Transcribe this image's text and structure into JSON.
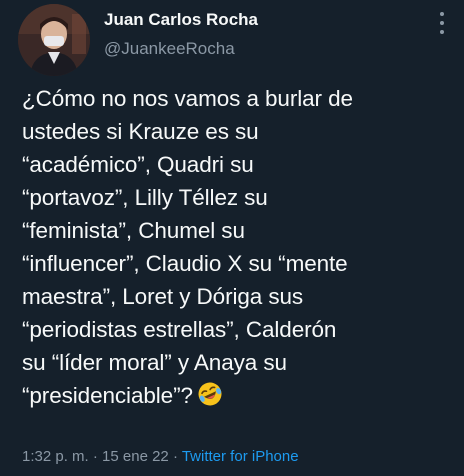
{
  "author": {
    "name": "Juan Carlos Rocha",
    "handle": "@JuankeeRocha"
  },
  "tweet": {
    "lines": [
      "¿Cómo no nos vamos a burlar de",
      "ustedes si Krauze es su",
      "“académico”, Quadri su",
      "“portavoz”, Lilly Téllez su",
      "“feminista”, Chumel su",
      "“influencer”, Claudio X su “mente",
      "maestra”, Loret y Dóriga sus",
      "“periodistas estrellas”, Calderón",
      "su “líder moral” y Anaya su",
      "“presidenciable”?"
    ],
    "emoji": "rolling-on-the-floor-laughing-icon"
  },
  "meta": {
    "time": "1:32 p. m.",
    "sep1": " · ",
    "date": "15 ene 22",
    "sep2": " · ",
    "source": "Twitter for iPhone"
  },
  "colors": {
    "background": "#15202b",
    "text": "#f7f9f9",
    "secondary": "#8b98a5",
    "link": "#1d9bf0"
  }
}
